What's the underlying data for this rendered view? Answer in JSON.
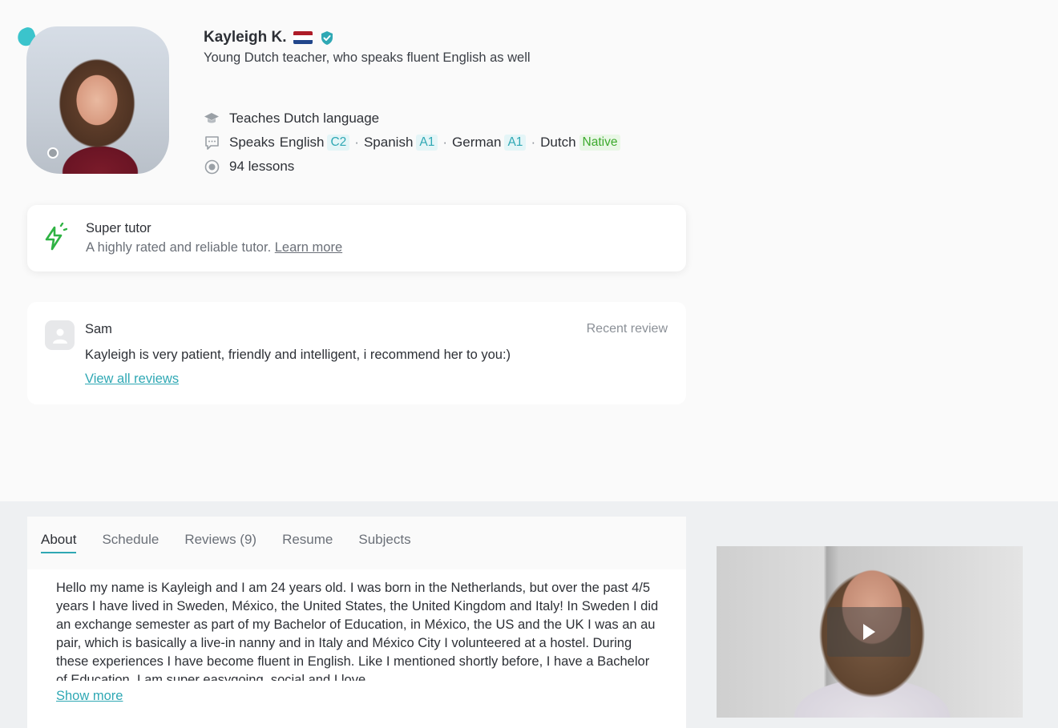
{
  "profile": {
    "name": "Kayleigh K.",
    "headline": "Young Dutch teacher, who speaks fluent English as well",
    "teaches": "Teaches Dutch language",
    "speaks_label": "Speaks",
    "languages": [
      {
        "name": "English",
        "level": "C2"
      },
      {
        "name": "Spanish",
        "level": "A1"
      },
      {
        "name": "German",
        "level": "A1"
      },
      {
        "name": "Dutch",
        "level": "Native"
      }
    ],
    "separator": "·",
    "lessons": "94 lessons",
    "flag_icon": "netherlands-flag-icon",
    "verified_icon": "verified-shield-icon"
  },
  "super_tutor": {
    "title": "Super tutor",
    "description": "A highly rated and reliable tutor.",
    "link": "Learn more"
  },
  "review": {
    "author": "Sam",
    "tag": "Recent review",
    "text": "Kayleigh is very patient, friendly and intelligent, i recommend her to you:)",
    "link": "View all reviews"
  },
  "tabs": [
    {
      "label": "About",
      "active": true
    },
    {
      "label": "Schedule",
      "active": false
    },
    {
      "label": "Reviews (9)",
      "active": false
    },
    {
      "label": "Resume",
      "active": false
    },
    {
      "label": "Subjects",
      "active": false
    }
  ],
  "about": {
    "text": "Hello my name is Kayleigh and I am 24 years old. I was born in the Netherlands, but over the past 4/5 years I have lived in Sweden, México, the United States, the United Kingdom and Italy! In Sweden I did an exchange semester as part of my Bachelor of Education, in México, the US and the UK I was an au pair, which is basically a live-in nanny and in Italy and México City I volunteered at a hostel. During these experiences I have become fluent in English. Like I mentioned shortly before, I have a Bachelor of Education. I am super easygoing, social and I love",
    "show_more": "Show more"
  },
  "colors": {
    "accent": "#2fa8b4",
    "native_green": "#3daa2e",
    "super_tutor_icon": "#2fb344"
  }
}
